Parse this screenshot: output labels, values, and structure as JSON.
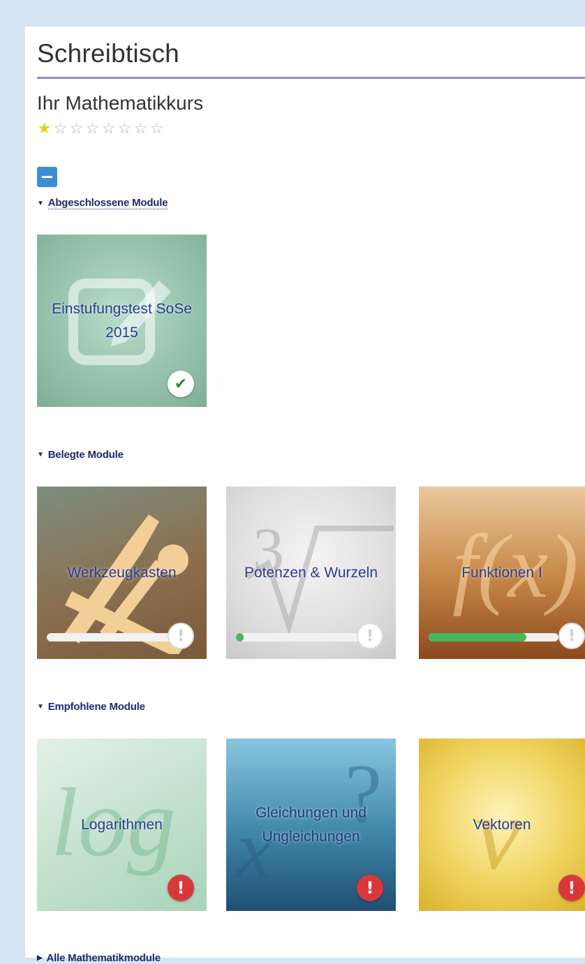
{
  "page": {
    "title": "Schreibtisch"
  },
  "course": {
    "title": "Ihr Mathematikkurs",
    "rating": 1,
    "rating_max": 8
  },
  "icons": {
    "collapse": "minus-icon",
    "star_full": "★",
    "star_empty": "☆",
    "check": "✔",
    "exclamation": "!"
  },
  "sections": {
    "completed": {
      "heading": "Abgeschlossene Module"
    },
    "enrolled": {
      "heading": "Belegte Module"
    },
    "recommended": {
      "heading": "Empfohlene Module"
    },
    "all": {
      "heading": "Alle Mathematikmodule"
    }
  },
  "modules": {
    "completed": [
      {
        "label": "Einstufungstest SoSe 2015",
        "status": "done"
      }
    ],
    "enrolled": [
      {
        "label": "Werkzeugkasten",
        "progress": 0.0,
        "status": "warn"
      },
      {
        "label": "Potenzen & Wurzeln",
        "progress": 0.06,
        "status": "warn"
      },
      {
        "label": "Funktionen I",
        "progress": 0.75,
        "status": "warn"
      }
    ],
    "recommended": [
      {
        "label": "Logarithmen",
        "status": "alert"
      },
      {
        "label": "Gleichungen und Ungleichungen",
        "status": "alert"
      },
      {
        "label": "Vektoren",
        "status": "alert"
      }
    ]
  },
  "colors": {
    "background": "#d5e5f4",
    "accent": "#3e8ed4",
    "progress": "#49b65d",
    "alert": "#d9383a",
    "section": "#1d2a6e"
  }
}
